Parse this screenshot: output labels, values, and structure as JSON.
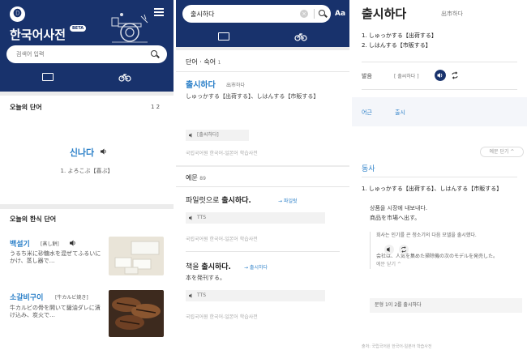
{
  "screen1": {
    "logo_glyph": "🅓",
    "app_title": "한국어사전",
    "beta_label": "BETA",
    "search_placeholder": "검색어 입력",
    "word_of_day": {
      "title": "오늘의 단어",
      "pager": "1 2",
      "word": "신나다",
      "meaning": "1. よろこぶ【喜ぶ】"
    },
    "hansik": {
      "title": "오늘의 한식 단어",
      "items": [
        {
          "word": "백설기",
          "tag": "[蒸し餅]",
          "desc": "うるち米に砂糖水を混ぜてふるいにかけ、蒸し器で…"
        },
        {
          "word": "소갈비구이",
          "tag": "[牛カルビ焼き]",
          "desc": "牛カルビの骨を開いて醤油ダレに漬け込み、炭火で…"
        }
      ]
    }
  },
  "screen2": {
    "search_value": "출시하다",
    "clear_label": "×",
    "aa_label": "Aa",
    "words_section": {
      "title": "단어 · 숙어",
      "count": "1"
    },
    "entry": {
      "word": "출시하다",
      "reading": "出市하다",
      "definition": "しゅっかする【出荷する】、しはんする【市販する】",
      "tts_label": "[출씨하다]",
      "source": "국립국어원 한국어-일본어 학습사전"
    },
    "examples_section": {
      "title": "예문",
      "count": "89"
    },
    "examples": [
      {
        "before": "파일럿으로 ",
        "bold": "출시하다.",
        "link": "→ 파일럿",
        "tts": "TTS",
        "source": "국립국어원 한국어-일본어 학습사전"
      },
      {
        "before": "책을 ",
        "bold": "출시하다.",
        "link": "→ 출시하다",
        "translation": "本を発刊する。",
        "tts": "TTS",
        "source": "국립국어원 한국어-일본어 학습사전"
      }
    ]
  },
  "screen3": {
    "word": "출시하다",
    "reading": "出市하다",
    "defs": [
      "1. しゅっかする【出荷する】",
      "2. しはんする【市販する】"
    ],
    "pron_label": "발음",
    "pron_value": "[ 출씨하다 ]",
    "origin_label": "어근",
    "origin_value": "출시",
    "view_more": "예문 단기 ^",
    "pos": "동사",
    "sense_ja": "1. しゅっかする【出荷する】、しはんする【市販する】",
    "sense_ko_1": "상품을 시장에 내보내다.",
    "sense_ko_2": "商品を市場へ出す。",
    "sense_ex_ko": "회사는 인기를 끈 청소기의 다음 모델을 출시했다.",
    "sense_ex_ja": "会社は、人気を集めた掃除機の次のモデルを発売した。",
    "sense_ex_more": "예문 닫기 ^",
    "sentence_bar": "문형  1이 2를 출시하다",
    "footer": "출처: 국립국어원 한국어-일본어 학습사전"
  },
  "colors": {
    "navy": "#18326c",
    "accent": "#2a7fc8",
    "bg": "#ececec"
  }
}
